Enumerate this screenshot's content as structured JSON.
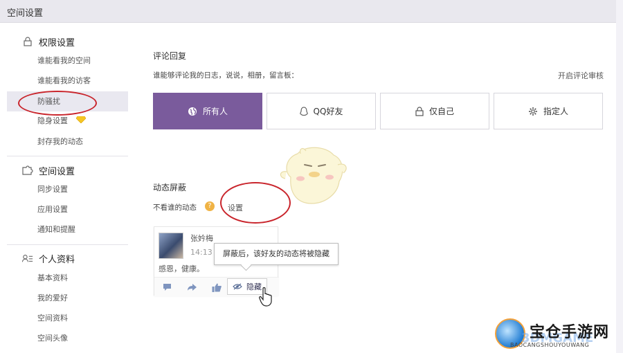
{
  "window": {
    "title": "空间设置"
  },
  "sidebar": {
    "sections": [
      {
        "title": "权限设置",
        "icon": "lock-icon",
        "items": [
          "谁能看我的空间",
          "谁能看我的访客",
          "防骚扰",
          "隐身设置",
          "封存我的动态"
        ]
      },
      {
        "title": "空间设置",
        "icon": "puzzle-icon",
        "items": [
          "同步设置",
          "应用设置",
          "通知和提醒"
        ]
      },
      {
        "title": "个人资料",
        "icon": "profile-card-icon",
        "items": [
          "基本资料",
          "我的爱好",
          "空间资料",
          "空间头像"
        ]
      }
    ],
    "active_item": "防骚扰",
    "premium_badge_icon": "diamond-icon"
  },
  "comment_reply": {
    "heading": "评论回复",
    "question": "谁能够评论我的日志，说说，相册，留言板：",
    "audit_link": "开启评论审核",
    "options": [
      {
        "label": "所有人",
        "icon": "globe-icon",
        "selected": true
      },
      {
        "label": "QQ好友",
        "icon": "qq-penguin-icon",
        "selected": false
      },
      {
        "label": "仅自己",
        "icon": "lock-icon",
        "selected": false
      },
      {
        "label": "指定人",
        "icon": "gear-icon",
        "selected": false
      }
    ]
  },
  "feed_block": {
    "heading": "动态屏蔽",
    "label": "不看谁的动态",
    "help_icon": "?",
    "set_link": "设置"
  },
  "sample_post": {
    "user": "张妗梅",
    "time": "14:13",
    "text": "感恩，健康。",
    "hide_label": "隐藏",
    "tooltip": "屏蔽后，该好友的动态将被隐藏"
  },
  "watermark": {
    "name": "宝仓手游网",
    "url": "BAOCANGSHOUYOUWANG",
    "overlay": "3DMGAME"
  },
  "colors": {
    "accent": "#7a5b9c",
    "highlight_circle": "#c9252c",
    "help_badge": "#f0b345"
  }
}
